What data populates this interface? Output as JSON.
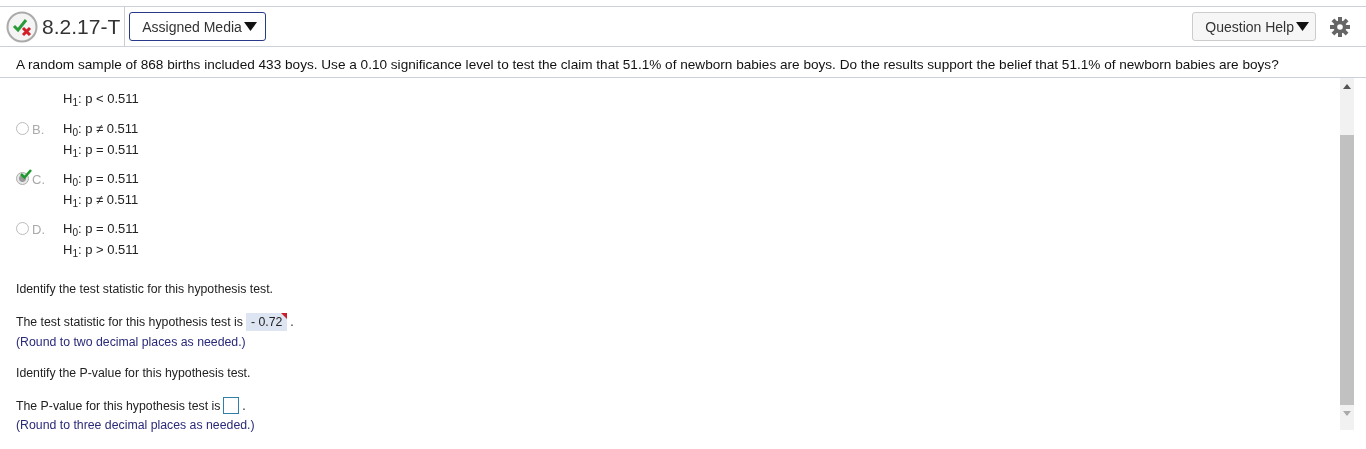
{
  "header": {
    "title": "8.2.17-T",
    "media_button": "Assigned Media",
    "help_button": "Question Help"
  },
  "question": "A random sample of 868 births included 433 boys. Use a 0.10 significance level to test the claim that 51.1% of newborn babies are boys. Do the results support the belief that 51.1% of newborn babies are boys?",
  "options": [
    {
      "lines": [
        "H$_{1}$: p < 0.511"
      ]
    },
    {
      "letter": "B.",
      "selected": false,
      "lines": [
        "H$_{0}$: p ≠ 0.511",
        "H$_{1}$: p = 0.511"
      ]
    },
    {
      "letter": "C.",
      "selected": true,
      "lines": [
        "H$_{0}$: p = 0.511",
        "H$_{1}$: p ≠ 0.511"
      ]
    },
    {
      "letter": "D.",
      "selected": false,
      "lines": [
        "H$_{0}$: p = 0.511",
        "H$_{1}$: p > 0.511"
      ]
    }
  ],
  "parts": [
    {
      "kind": "prompt",
      "text": "Identify the test statistic for this hypothesis test."
    },
    {
      "kind": "answer",
      "text": "The test statistic for this hypothesis test is",
      "value": "- 0.72",
      "flagged": true,
      "after": ".",
      "note": "(Round to two decimal places as needed.)"
    },
    {
      "kind": "prompt",
      "text": "Identify the P-value for this hypothesis test."
    },
    {
      "kind": "answer",
      "text": "The P-value for this hypothesis test is",
      "flagged": false,
      "after": ".",
      "note": "(Round to three decimal places as needed.)"
    }
  ]
}
